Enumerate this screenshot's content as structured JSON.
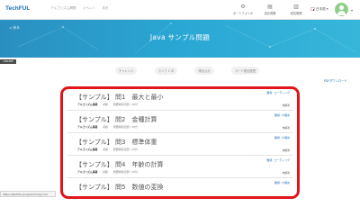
{
  "header": {
    "logo": "TechFUL",
    "nav": [
      "アルゴリズム問題",
      "イベント",
      "本日"
    ],
    "items": [
      {
        "label": "ポートフォリオ",
        "icon": "portfolio-icon"
      },
      {
        "label": "過去受験",
        "icon": "history-icon"
      },
      {
        "label": "成長管理",
        "icon": "growth-icon"
      }
    ],
    "language": "日本語"
  },
  "banner": {
    "back": "< 戻る",
    "title": "Java サンプル問題",
    "badge": "ONLINE"
  },
  "tabs": [
    "チャレンジ",
    "ランク 2 中",
    "得点公示",
    "コード提出履歴"
  ],
  "pdf_link": "PDFダウンロード",
  "questions": [
    {
      "title": "【サンプル】 問1　最大と最小",
      "tag": "難易: コーディング",
      "category": "アルゴリズム基礎",
      "rank": "初級",
      "time": "所要時間(目安): 20分",
      "status": "未解答"
    },
    {
      "title": "【サンプル】 問2　金種計算",
      "tag": "難易: 穴埋め",
      "category": "アルゴリズム基礎",
      "rank": "初級",
      "time": "所要時間(目安): 20分",
      "status": "未解答"
    },
    {
      "title": "【サンプル】 問3　標準体重",
      "tag": "難易: 穴埋め",
      "category": "アルゴリズム基礎",
      "rank": "初級",
      "time": "所要時間(目安): 20分",
      "status": "未解答"
    },
    {
      "title": "【サンプル】 問4　年齢の計算",
      "tag": "難易: コーディング",
      "category": "アルゴリズム基礎",
      "rank": "初級",
      "time": "所要時間(目安): 20分",
      "status": "未解答"
    },
    {
      "title": "【サンプル】 問5　数値の変換",
      "tag": "難易: 穴埋め",
      "category": "アルゴリズム基礎",
      "rank": "初級",
      "time": "所要時間(目安): 20分",
      "status": "未解答"
    }
  ],
  "statusbar": "https://techful-programming.com",
  "colors": {
    "banner": "#2aa7d4",
    "accent": "#1a6fb5",
    "frame": "#e0161b"
  }
}
